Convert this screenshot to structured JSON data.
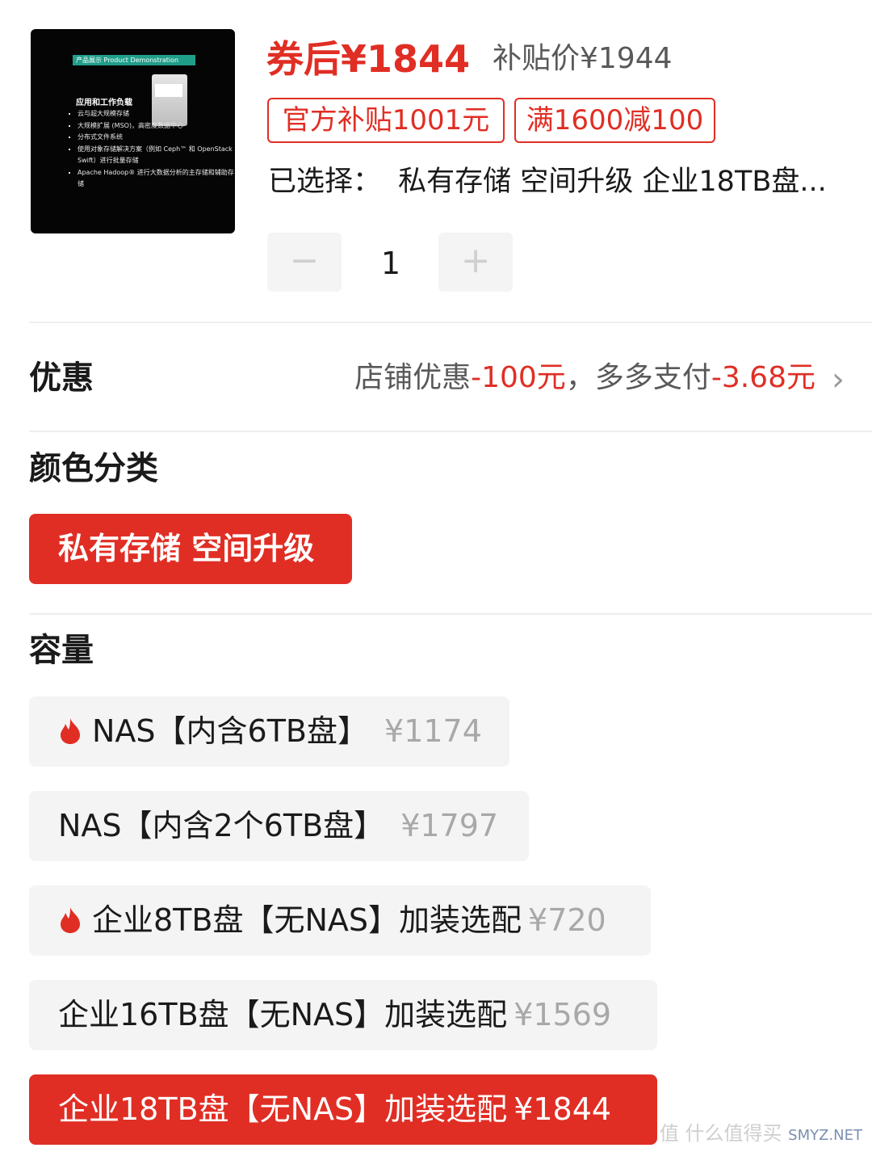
{
  "product": {
    "image": {
      "banner": "产品展示  Product Demonstration",
      "heading": "应用和工作负载",
      "bullets": [
        "云与超大规模存储",
        "大规模扩展 (MSO)，高密度数据中心",
        "分布式文件系统",
        "使用对象存储解决方案（例如 Ceph™ 和 OpenStack Swift）进行批量存储",
        "Apache Hadoop® 进行大数据分析的主存储和辅助存储"
      ]
    },
    "price_after_coupon": "券后¥1844",
    "subsidy_price": "补贴价¥1944",
    "tags": [
      "官方补贴1001元",
      "满1600减100"
    ],
    "selected_label": "已选择：",
    "selected_value": "私有存储 空间升级 企业18TB盘..."
  },
  "stepper": {
    "minus": "−",
    "quantity": "1",
    "plus": "+"
  },
  "promo": {
    "title": "优惠",
    "store_label": "店铺优惠",
    "store_value": "-100元",
    "sep": "，",
    "pay_label": "多多支付",
    "pay_value": "-3.68元",
    "chevron": "›"
  },
  "color_section": {
    "title": "颜色分类",
    "options": [
      {
        "label": "私有存储 空间升级",
        "selected": true
      }
    ]
  },
  "capacity_section": {
    "title": "容量",
    "options": [
      {
        "label": "NAS【内含6TB盘】",
        "price": "¥1174",
        "hot": true,
        "selected": false
      },
      {
        "label": "NAS【内含2个6TB盘】",
        "price": "¥1797",
        "hot": false,
        "selected": false
      },
      {
        "label": "企业8TB盘【无NAS】加装选配",
        "price": "¥720",
        "hot": true,
        "selected": false
      },
      {
        "label": "企业16TB盘【无NAS】加装选配",
        "price": "¥1569",
        "hot": false,
        "selected": false
      },
      {
        "label": "企业18TB盘【无NAS】加装选配",
        "price": "¥1844",
        "hot": false,
        "selected": true
      }
    ]
  },
  "watermark": {
    "text": "值 什么值得买",
    "site": "SMYZ.NET"
  },
  "colors": {
    "accent": "#e02e24",
    "chip_bg": "#f4f4f4",
    "muted": "#595959"
  }
}
